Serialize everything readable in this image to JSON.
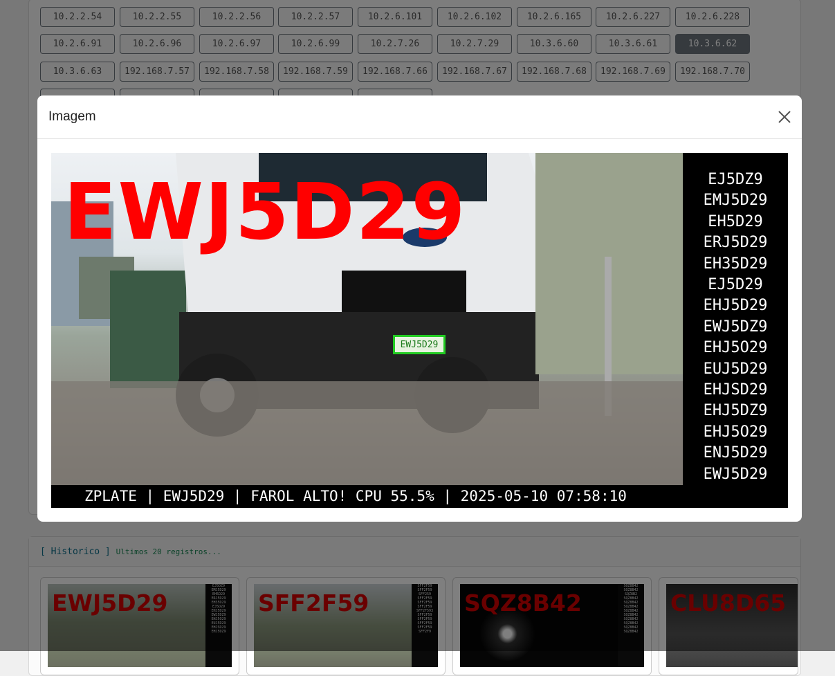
{
  "ip_list": {
    "rows": [
      [
        "10.2.2.54",
        "10.2.2.55",
        "10.2.2.56",
        "10.2.2.57",
        "10.2.6.101",
        "10.2.6.102",
        "10.2.6.165",
        "10.2.6.227",
        "10.2.6.228"
      ],
      [
        "10.2.6.91",
        "10.2.6.96",
        "10.2.6.97",
        "10.2.6.99",
        "10.2.7.26",
        "10.2.7.29",
        "10.3.6.60",
        "10.3.6.61",
        "10.3.6.62"
      ],
      [
        "10.3.6.63",
        "192.168.7.57",
        "192.168.7.58",
        "192.168.7.59",
        "192.168.7.66",
        "192.168.7.67",
        "192.168.7.68",
        "192.168.7.69",
        "192.168.7.70"
      ]
    ],
    "active": "10.3.6.62"
  },
  "modal": {
    "title": "Imagem",
    "close_icon": "close-icon",
    "image": {
      "plate_overlay": "EWJ5D29",
      "detected_plate": "EWJ5D29",
      "candidates": [
        "EJ5DZ9",
        "EMJ5D29",
        "EH5D29",
        "ERJ5D29",
        "EH35D29",
        "EJ5D29",
        "EHJ5D29",
        "EWJ5DZ9",
        "EHJ5O29",
        "EUJ5D29",
        "EHJSD29",
        "EHJ5DZ9",
        "EHJ5O29",
        "ENJ5D29",
        "EWJ5D29"
      ],
      "footer": "ZPLATE | EWJ5D29 | FAROL ALTO! CPU 55.5% | 2025-05-10 07:58:10"
    }
  },
  "history": {
    "title": "[ Historico ]",
    "subtitle": "Ultimos 20 registros...",
    "items": [
      {
        "plate": "EWJ5D29",
        "candidates": [
          "EJ5DZ9",
          "EMJ5D29",
          "EH5D29",
          "ERJ5D29",
          "EH35D29",
          "EJ5D29",
          "EHJ5D29",
          "EWJ5DZ9",
          "EHJ5O29",
          "EUJ5D29",
          "EHJSD29",
          "EHJ5DZ9"
        ]
      },
      {
        "plate": "SFF2F59",
        "candidates": [
          "SFF2F59",
          "SFF2F59",
          "SFF259",
          "SFF2F59",
          "SFF2F59",
          "SFF2F59",
          "SFF2F593",
          "SFF2F59",
          "SFF2F59",
          "SFF2F59",
          "SFF2F59",
          "SFF2F9"
        ]
      },
      {
        "plate": "SQZ8B42",
        "candidates": [
          "SQZ8B42",
          "SQZ8B42",
          "SQZ8B2",
          "SQZ8B42",
          "SQZ8B42",
          "SQZ8B42",
          "SQZ8B42",
          "SQZ8B42",
          "SQZ8B42",
          "SQZ8B42",
          "SQZ8B42",
          "SQZ8B42"
        ]
      },
      {
        "plate": "CLU8D65",
        "candidates": []
      }
    ]
  }
}
